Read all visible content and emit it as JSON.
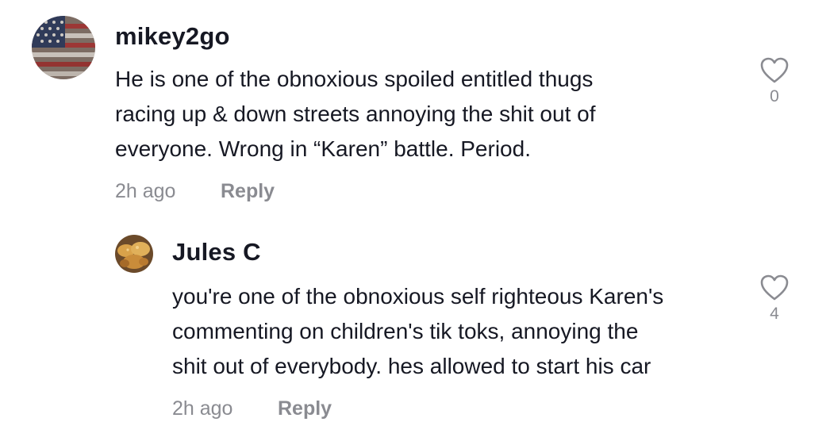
{
  "comments": [
    {
      "username": "mikey2go",
      "text": "He is one of the obnoxious spoiled entitled thugs\nracing up & down streets annoying the shit out of\neveryone. Wrong in “Karen” battle. Period.",
      "time": "2h ago",
      "reply_label": "Reply",
      "likes": "0",
      "avatar_icon": "american-flag-avatar"
    },
    {
      "username": "Jules C",
      "text": "you're one of the obnoxious self righteous Karen's\ncommenting on children's tik toks, annoying the\nshit out of everybody. hes allowed to start his car",
      "time": "2h ago",
      "reply_label": "Reply",
      "likes": "4",
      "avatar_icon": "food-photo-avatar"
    }
  ],
  "colors": {
    "text_primary": "#161823",
    "text_secondary": "#8a8b91",
    "background": "#ffffff"
  }
}
